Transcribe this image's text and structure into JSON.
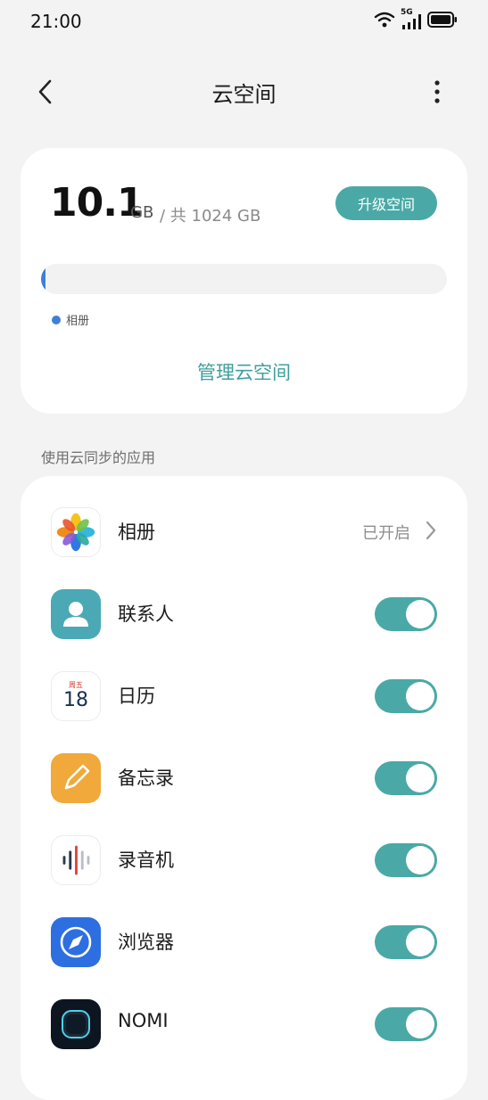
{
  "status_bar": {
    "time": "21:00",
    "network": "5G"
  },
  "nav": {
    "title": "云空间"
  },
  "storage": {
    "used_value": "10.1",
    "used_unit": "GB",
    "total_text": "/ 共 1024 GB",
    "used_fraction": 0.0099,
    "upgrade_label": "升级空间",
    "legend_label": "相册",
    "manage_label": "管理云空间"
  },
  "section_label": "使用云同步的应用",
  "apps": [
    {
      "name": "相册",
      "status": "已开启",
      "icon": "photos-icon"
    },
    {
      "name": "联系人",
      "toggle_on": true,
      "icon": "contacts-icon"
    },
    {
      "name": "日历",
      "toggle_on": true,
      "icon": "calendar-icon",
      "icon_weekday": "周五",
      "icon_day": "18"
    },
    {
      "name": "备忘录",
      "toggle_on": true,
      "icon": "notes-icon"
    },
    {
      "name": "录音机",
      "toggle_on": true,
      "icon": "recorder-icon"
    },
    {
      "name": "浏览器",
      "toggle_on": true,
      "icon": "browser-icon"
    },
    {
      "name": "NOMI",
      "toggle_on": true,
      "icon": "nomi-icon"
    }
  ],
  "colors": {
    "accent": "#4aa9a6",
    "progress": "#3d7fd9"
  }
}
